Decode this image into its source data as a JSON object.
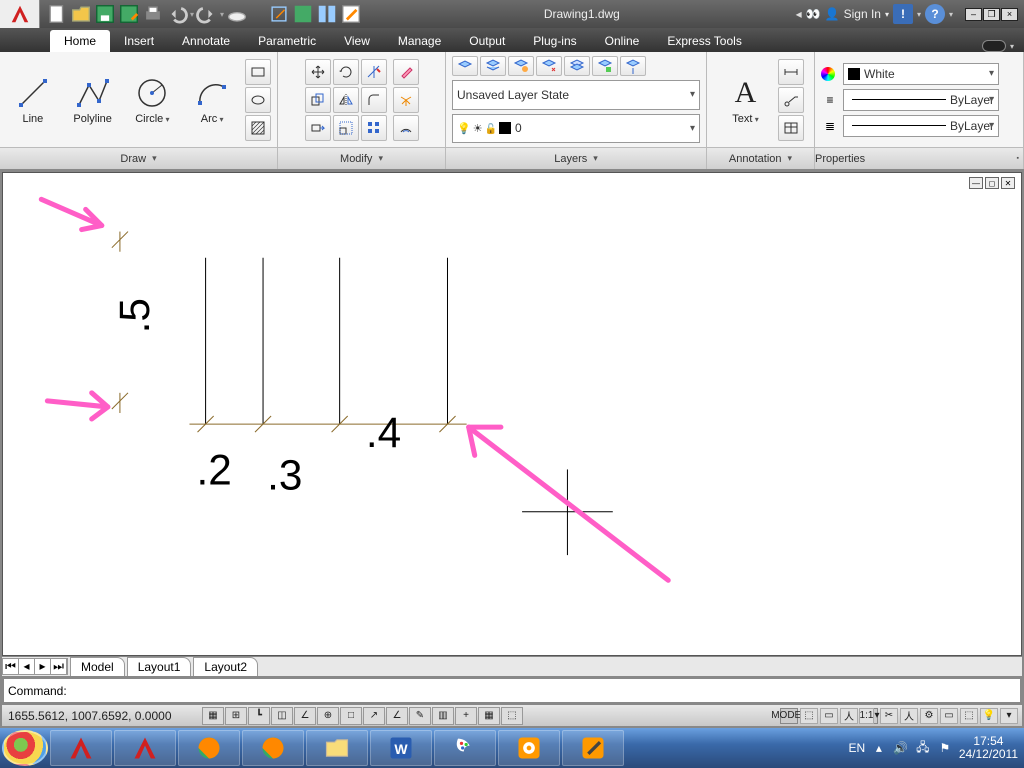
{
  "title": "Drawing1.dwg",
  "signin": "Sign In",
  "tabs": [
    "Home",
    "Insert",
    "Annotate",
    "Parametric",
    "View",
    "Manage",
    "Output",
    "Plug-ins",
    "Online",
    "Express Tools"
  ],
  "active_tab": 0,
  "panels": {
    "draw": {
      "label": "Draw",
      "line": "Line",
      "polyline": "Polyline",
      "circle": "Circle",
      "arc": "Arc"
    },
    "modify": {
      "label": "Modify"
    },
    "layers": {
      "label": "Layers",
      "state": "Unsaved Layer State",
      "current": "0"
    },
    "annotation": {
      "label": "Annotation",
      "text": "Text"
    },
    "properties": {
      "label": "Properties",
      "color": "White",
      "ltype": "ByLayer",
      "lweight": "ByLayer"
    }
  },
  "canvas": {
    "dims": {
      "d2": ".2",
      "d3": ".3",
      "d4": ".4",
      "d5": ".5"
    }
  },
  "model_tabs": [
    "Model",
    "Layout1",
    "Layout2"
  ],
  "command_prompt": "Command:",
  "status": {
    "coords": "1655.5612, 1007.6592, 0.0000",
    "model": "MODEL",
    "scale": "1:1"
  },
  "tray": {
    "lang": "EN",
    "time": "17:54",
    "date": "24/12/2011"
  }
}
